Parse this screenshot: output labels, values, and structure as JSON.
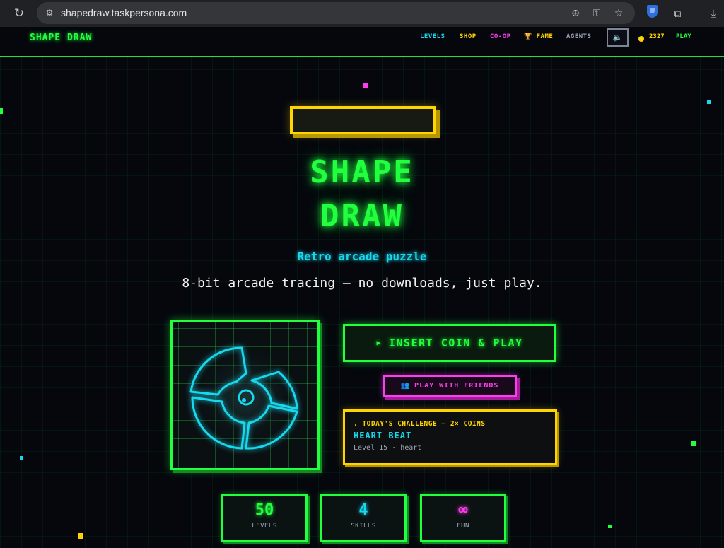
{
  "browser": {
    "url": "shapedraw.taskpersona.com",
    "icons": [
      "reload-icon",
      "site-settings-icon",
      "zoom-icon",
      "key-icon",
      "star-icon",
      "shield-extension-icon",
      "puzzle-icon",
      "download-icon"
    ]
  },
  "nav": {
    "logo": "SHAPE DRAW",
    "levels": "LEVELS",
    "shop": "SHOP",
    "coop": "CO-OP",
    "fame": "🏆 FAME",
    "agents": "AGENTS",
    "mute_icon": "🔈",
    "coins": "2327",
    "play": "PLAY"
  },
  "hero": {
    "title_line1": "SHAPE",
    "title_line2": "DRAW",
    "subtitle": "Retro arcade puzzle",
    "tagline": "8-bit arcade tracing — no downloads, just play."
  },
  "actions": {
    "play_icon": "▶",
    "play_label": "INSERT COIN & PLAY",
    "friends_icon": "👥",
    "friends_label": "PLAY WITH FRIENDS"
  },
  "challenge": {
    "heading": ". TODAY'S CHALLENGE — 2× COINS",
    "title": "HEART BEAT",
    "subtitle": "Level 15 · heart"
  },
  "stats": [
    {
      "value": "50",
      "label": "LEVELS",
      "color": "#22ff3e"
    },
    {
      "value": "4",
      "label": "SKILLS",
      "color": "#18d8ee"
    },
    {
      "value": "∞",
      "label": "FUN",
      "color": "#ff3df0"
    }
  ],
  "colors": {
    "green": "#22ff3e",
    "cyan": "#18d8ee",
    "magenta": "#ff3df0",
    "yellow": "#ffd400",
    "background": "#05070d"
  }
}
